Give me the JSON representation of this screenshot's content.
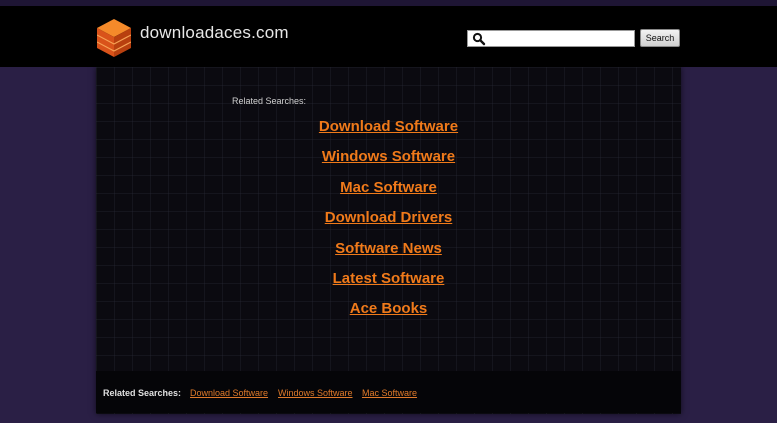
{
  "header": {
    "site_name": "downloadaces.com",
    "search": {
      "value": "",
      "placeholder": "",
      "button_label": "Search"
    }
  },
  "main": {
    "related_title": "Related Searches:",
    "links": [
      "Download Software",
      "Windows Software",
      "Mac Software",
      "Download Drivers",
      "Software News",
      "Latest Software",
      "Ace Books"
    ]
  },
  "footer": {
    "label": "Related Searches:",
    "links": [
      "Download Software",
      "Windows Software",
      "Mac Software"
    ]
  },
  "colors": {
    "link": "#f07a1a",
    "header_bg": "#000000",
    "page_bg": "#2a1f45",
    "panel_bg": "#0b0a10"
  },
  "icons": {
    "logo": "orange-layered-box-icon",
    "search": "magnifier-icon"
  }
}
